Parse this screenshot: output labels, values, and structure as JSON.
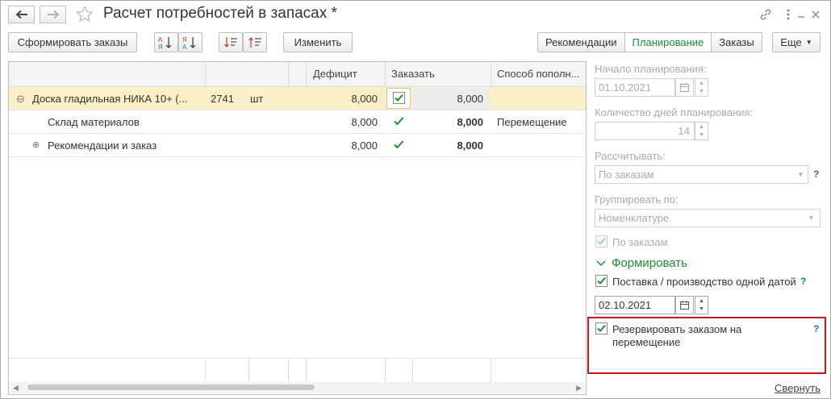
{
  "window": {
    "title": "Расчет потребностей в запасах *"
  },
  "toolbar": {
    "form_orders_label": "Сформировать заказы",
    "edit_label": "Изменить",
    "more_label": "Еще",
    "sort_asc_glyph": "А↓Я",
    "sort_desc_glyph": "Я↓А",
    "tabs": [
      {
        "label": "Рекомендации"
      },
      {
        "label": "Планирование"
      },
      {
        "label": "Заказы"
      }
    ]
  },
  "table": {
    "columns": [
      "",
      "",
      "",
      "Дефицит",
      "Заказать",
      "Способ пополн..."
    ],
    "rows": [
      {
        "expander": "⊖",
        "name": "Доска гладильная  НИКА 10+ (...",
        "code": "2741",
        "unit": "шт",
        "deficit": "8,000",
        "order": "8,000",
        "method": "",
        "checked": true
      },
      {
        "expander": "",
        "name": "Склад материалов",
        "code": "",
        "unit": "",
        "deficit": "8,000",
        "order": "8,000",
        "method": "Перемещение",
        "checked": true
      },
      {
        "expander": "⊕",
        "name": "Рекомендации и заказ",
        "code": "",
        "unit": "",
        "deficit": "8,000",
        "order": "8,000",
        "method": "",
        "checked": true
      }
    ]
  },
  "panel": {
    "start_label": "Начало планирования:",
    "start_value": "01.10.2021",
    "days_label": "Количество дней планирования:",
    "days_value": "14",
    "calc_label": "Рассчитывать:",
    "calc_value": "По заказам",
    "group_label": "Группировать по:",
    "group_value": "Номенклатуре",
    "by_orders_label": "По заказам",
    "form_group_label": "Формировать",
    "single_date_label": "Поставка / производство одной датой",
    "date_value": "02.10.2021",
    "reserve_label_1": "Резервировать заказом на",
    "reserve_label_2": "перемещение",
    "help": "?",
    "collapse_label": "Свернуть"
  },
  "colors": {
    "accent_green": "#1a8f35",
    "selected_row": "#fbefc6",
    "highlight_border": "#c41a1a",
    "help_blue": "#2a73b8"
  }
}
